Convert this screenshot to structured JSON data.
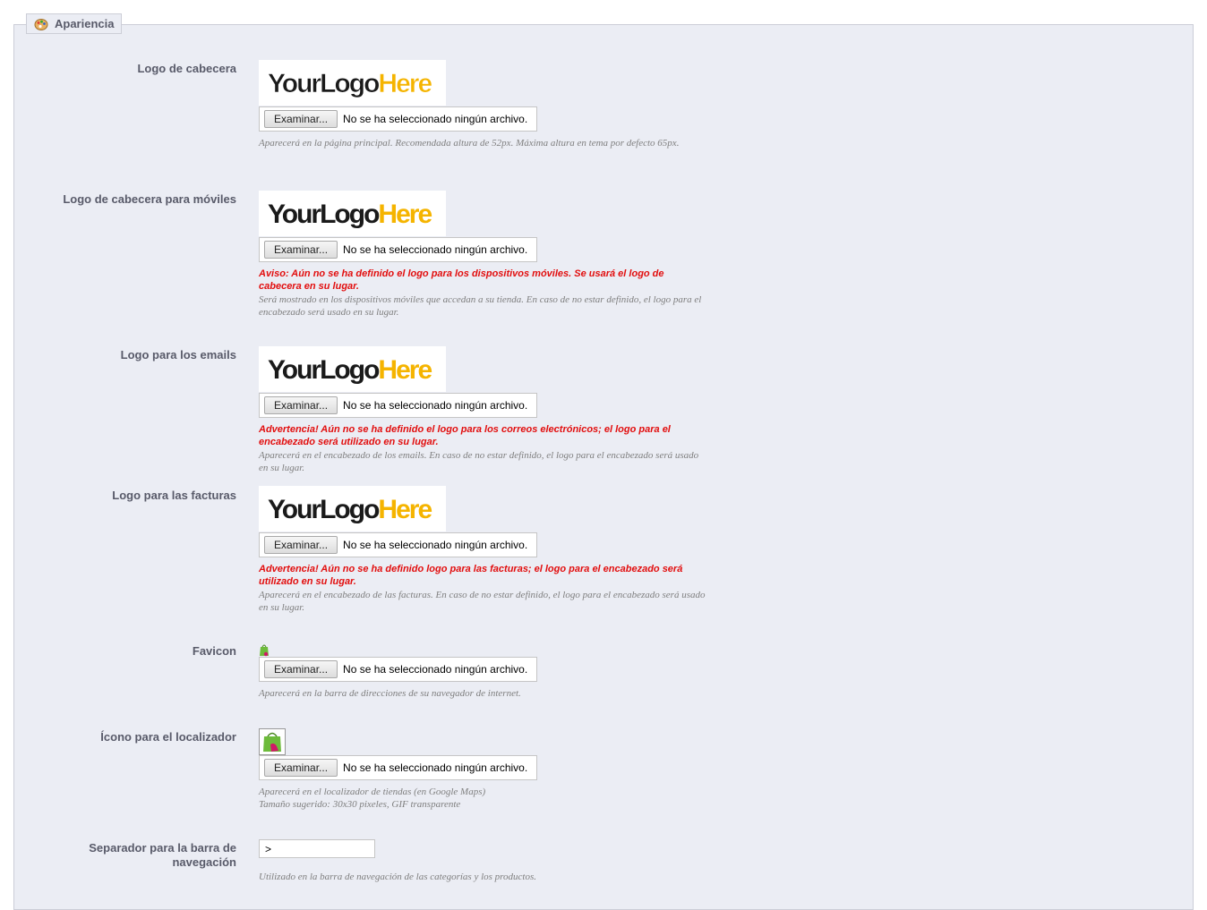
{
  "legend": {
    "title": "Apariencia",
    "icon": "palette-icon"
  },
  "file_button_label": "Examinar...",
  "no_file_text": "No se ha seleccionado ningún archivo.",
  "logo_text": {
    "part1": "YourLogo",
    "part2": "Here"
  },
  "fields": {
    "header_logo": {
      "label": "Logo de cabecera",
      "hint": "Aparecerá en la página principal. Recomendada altura de 52px. Máxima altura en tema por defecto 65px."
    },
    "mobile_logo": {
      "label": "Logo de cabecera para móviles",
      "warning": "Aviso: Aún no se ha definido el logo para los dispositivos móviles. Se usará el logo de cabecera en su lugar.",
      "hint": "Será mostrado en los dispositivos móviles que accedan a su tienda. En caso de no estar definido, el logo para el encabezado será usado en su lugar."
    },
    "email_logo": {
      "label": "Logo para los emails",
      "warning": "Advertencia! Aún no se ha definido el logo para los correos electrónicos; el logo para el encabezado será utilizado en su lugar.",
      "hint": "Aparecerá en el encabezado de los emails. En caso de no estar definido, el logo para el encabezado será usado en su lugar."
    },
    "invoice_logo": {
      "label": "Logo para las facturas",
      "warning": "Advertencia! Aún no se ha definido logo para las facturas; el logo para el encabezado será utilizado en su lugar.",
      "hint": "Aparecerá en el encabezado de las facturas. En caso de no estar definido, el logo para el encabezado será usado en su lugar."
    },
    "favicon": {
      "label": "Favicon",
      "hint": "Aparecerá en la barra de direcciones de su navegador de internet."
    },
    "store_icon": {
      "label": "Ícono para el localizador",
      "hint_line1": "Aparecerá en el localizador de tiendas (en Google Maps)",
      "hint_line2": "Tamaño sugerido: 30x30 pixeles, GIF transparente"
    },
    "separator": {
      "label": "Separador para la barra de navegación",
      "value": ">",
      "hint": "Utilizado en la barra de navegación de las categorías y los productos."
    }
  },
  "colors": {
    "panel_bg": "#ebedf4",
    "label": "#585a69",
    "warning": "#e20e0e",
    "hint": "#7f7f7f"
  }
}
